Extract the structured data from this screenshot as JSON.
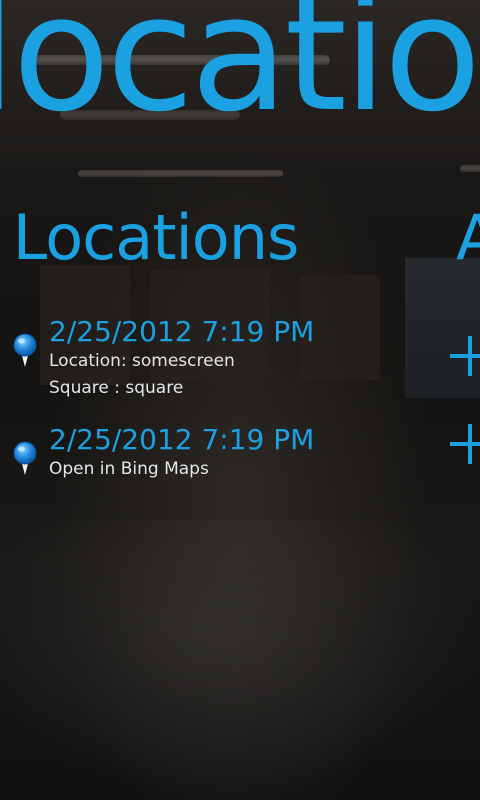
{
  "panorama": {
    "title": "locations"
  },
  "section": {
    "header": "Locations",
    "next_header": "A"
  },
  "items": [
    {
      "title": "2/25/2012 7:19 PM",
      "lines": [
        "Location: somescreen",
        "Square : square"
      ],
      "icon": "map-pin-icon"
    },
    {
      "title": "2/25/2012 7:19 PM",
      "lines": [
        "Open in Bing Maps"
      ],
      "icon": "map-pin-icon"
    }
  ],
  "next_panel_icons": [
    "add-icon",
    "add-icon"
  ],
  "colors": {
    "accent": "#1ba1e2",
    "text": "#e6e6e6",
    "background": "#1a1816"
  }
}
